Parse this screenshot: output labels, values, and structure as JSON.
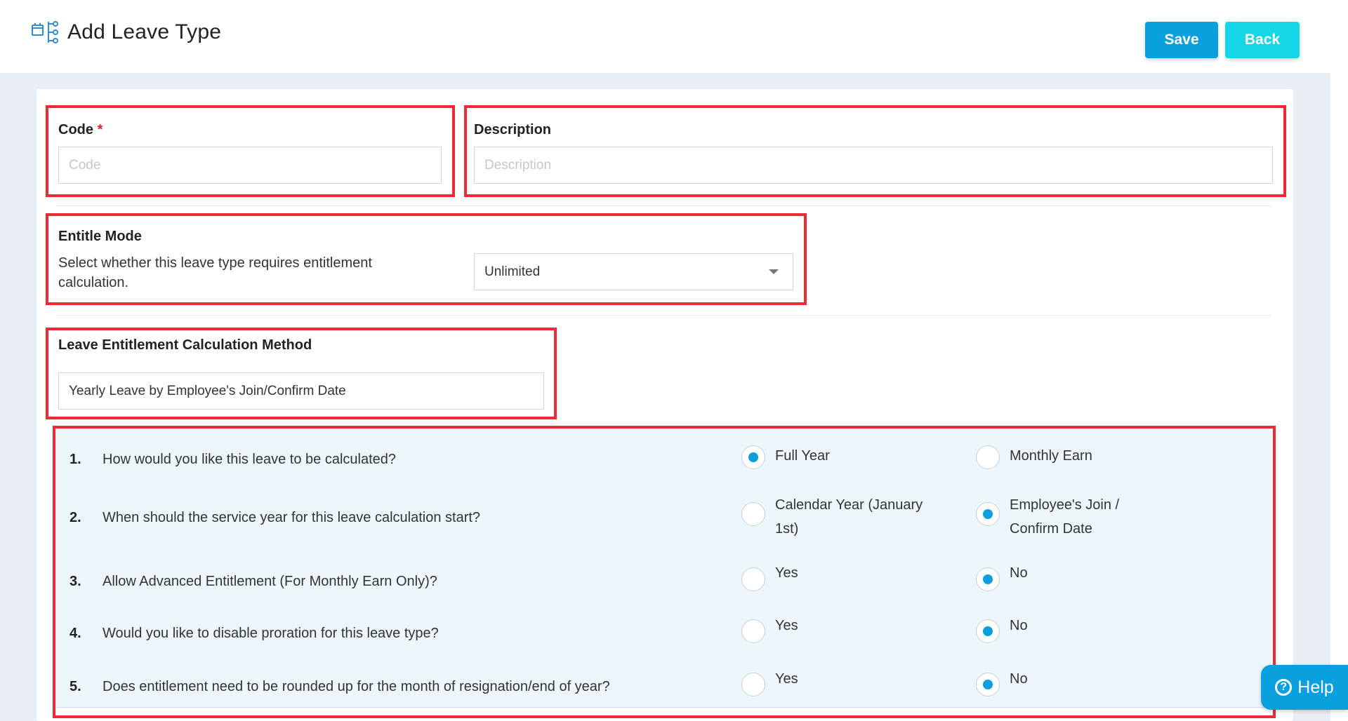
{
  "header": {
    "title": "Add Leave Type",
    "title_icon": "leave-type-structure-icon",
    "save_label": "Save",
    "back_label": "Back"
  },
  "form": {
    "code": {
      "label": "Code",
      "required_mark": "*",
      "placeholder": "Code",
      "value": ""
    },
    "description": {
      "label": "Description",
      "placeholder": "Description",
      "value": ""
    },
    "entitle_mode": {
      "label": "Entitle Mode",
      "hint": "Select whether this leave type requires entitlement calculation.",
      "selected": "Unlimited"
    },
    "calculation_method": {
      "label": "Leave Entitlement Calculation Method",
      "value": "Yearly Leave by Employee's Join/Confirm Date"
    }
  },
  "questions": [
    {
      "num": "1.",
      "text": "How would you like this leave to be calculated?",
      "opt_a": "Full Year",
      "opt_b": "Monthly Earn",
      "selected": "a"
    },
    {
      "num": "2.",
      "text": "When should the service year for this leave calculation start?",
      "opt_a": "Calendar Year (January 1st)",
      "opt_b": "Employee's Join / Confirm Date",
      "selected": "b"
    },
    {
      "num": "3.",
      "text": "Allow Advanced Entitlement (For Monthly Earn Only)?",
      "opt_a": "Yes",
      "opt_b": "No",
      "selected": "b"
    },
    {
      "num": "4.",
      "text": "Would you like to disable proration for this leave type?",
      "opt_a": "Yes",
      "opt_b": "No",
      "selected": "b"
    },
    {
      "num": "5.",
      "text": "Does entitlement need to be rounded up for the month of resignation/end of year?",
      "opt_a": "Yes",
      "opt_b": "No",
      "selected": "b"
    }
  ],
  "help": {
    "label": "Help",
    "icon": "question-circle-icon"
  },
  "colors": {
    "accent": "#0aa0e0",
    "back_button": "#14d6e6",
    "highlight": "#ee2a34",
    "question_bg": "#edf7fb"
  }
}
